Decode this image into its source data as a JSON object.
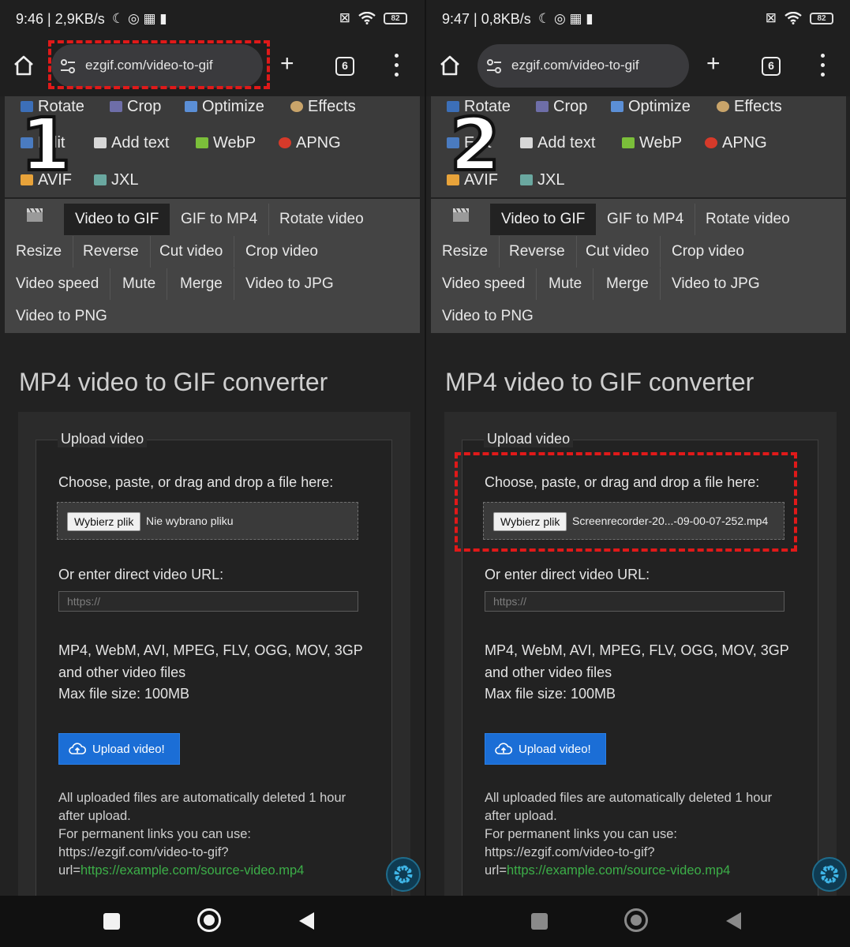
{
  "panels": [
    {
      "status": {
        "time": "9:46 | 2,9KB/s",
        "battery": "82"
      },
      "toolbar": {
        "url": "ezgif.com/video-to-gif",
        "tab_count": "6"
      },
      "step_number": "1",
      "file": {
        "button": "Wybierz plik",
        "filename": "Nie wybrano pliku"
      }
    },
    {
      "status": {
        "time": "9:47 | 0,8KB/s",
        "battery": "82"
      },
      "toolbar": {
        "url": "ezgif.com/video-to-gif",
        "tab_count": "6"
      },
      "step_number": "2",
      "file": {
        "button": "Wybierz plik",
        "filename": "Screenrecorder-20...-09-00-07-252.mp4"
      }
    }
  ],
  "tools": [
    "Rotate",
    "Crop",
    "Optimize",
    "Effects",
    "Edit",
    "Add text",
    "WebP",
    "APNG",
    "AVIF",
    "JXL"
  ],
  "video_nav": [
    "Video to GIF",
    "GIF to MP4",
    "Rotate video",
    "Resize",
    "Reverse",
    "Cut video",
    "Crop video",
    "Video speed",
    "Mute",
    "Merge",
    "Video to JPG",
    "Video to PNG"
  ],
  "page_title": "MP4 video to GIF converter",
  "upload": {
    "legend": "Upload video",
    "choose_label": "Choose, paste, or drag and drop a file here:",
    "url_label": "Or enter direct video URL:",
    "url_placeholder": "https://",
    "formats_line1": "MP4, WebM, AVI, MPEG, FLV, OGG, MOV, 3GP",
    "formats_line2": "and other video files",
    "max_size": "Max file size: 100MB",
    "button": "Upload video!",
    "note1": "All uploaded files are automatically deleted 1 hour",
    "note2": "after upload.",
    "note3": "For permanent links you can use:",
    "note4": "https://ezgif.com/video-to-gif?",
    "note5_prefix": "url=",
    "note5_link": "https://example.com/source-video.mp4"
  },
  "colors": {
    "accent_blue": "#1b6ed6",
    "link_green": "#3cae48",
    "annotation_red": "#e01919"
  }
}
